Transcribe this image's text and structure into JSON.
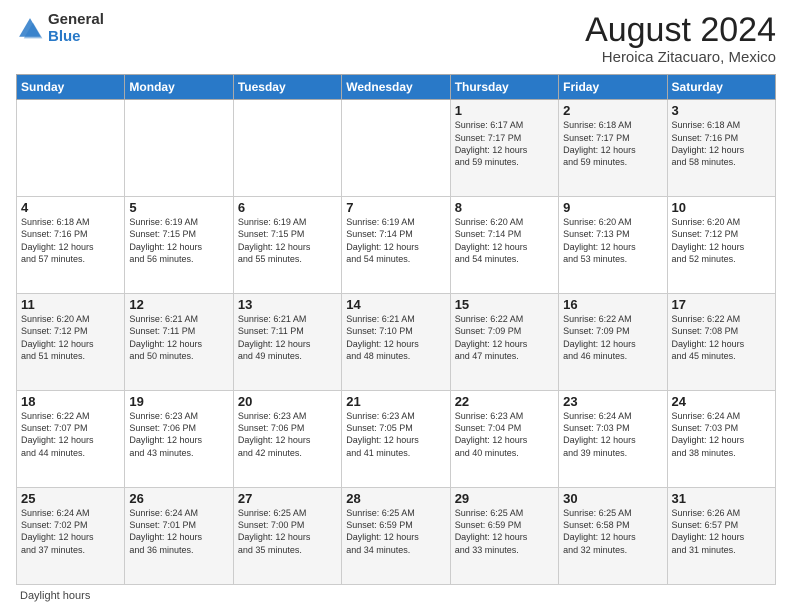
{
  "logo": {
    "general": "General",
    "blue": "Blue"
  },
  "title": "August 2024",
  "subtitle": "Heroica Zitacuaro, Mexico",
  "weekdays": [
    "Sunday",
    "Monday",
    "Tuesday",
    "Wednesday",
    "Thursday",
    "Friday",
    "Saturday"
  ],
  "footer_label": "Daylight hours",
  "weeks": [
    [
      {
        "day": "",
        "info": ""
      },
      {
        "day": "",
        "info": ""
      },
      {
        "day": "",
        "info": ""
      },
      {
        "day": "",
        "info": ""
      },
      {
        "day": "1",
        "info": "Sunrise: 6:17 AM\nSunset: 7:17 PM\nDaylight: 12 hours\nand 59 minutes."
      },
      {
        "day": "2",
        "info": "Sunrise: 6:18 AM\nSunset: 7:17 PM\nDaylight: 12 hours\nand 59 minutes."
      },
      {
        "day": "3",
        "info": "Sunrise: 6:18 AM\nSunset: 7:16 PM\nDaylight: 12 hours\nand 58 minutes."
      }
    ],
    [
      {
        "day": "4",
        "info": "Sunrise: 6:18 AM\nSunset: 7:16 PM\nDaylight: 12 hours\nand 57 minutes."
      },
      {
        "day": "5",
        "info": "Sunrise: 6:19 AM\nSunset: 7:15 PM\nDaylight: 12 hours\nand 56 minutes."
      },
      {
        "day": "6",
        "info": "Sunrise: 6:19 AM\nSunset: 7:15 PM\nDaylight: 12 hours\nand 55 minutes."
      },
      {
        "day": "7",
        "info": "Sunrise: 6:19 AM\nSunset: 7:14 PM\nDaylight: 12 hours\nand 54 minutes."
      },
      {
        "day": "8",
        "info": "Sunrise: 6:20 AM\nSunset: 7:14 PM\nDaylight: 12 hours\nand 54 minutes."
      },
      {
        "day": "9",
        "info": "Sunrise: 6:20 AM\nSunset: 7:13 PM\nDaylight: 12 hours\nand 53 minutes."
      },
      {
        "day": "10",
        "info": "Sunrise: 6:20 AM\nSunset: 7:12 PM\nDaylight: 12 hours\nand 52 minutes."
      }
    ],
    [
      {
        "day": "11",
        "info": "Sunrise: 6:20 AM\nSunset: 7:12 PM\nDaylight: 12 hours\nand 51 minutes."
      },
      {
        "day": "12",
        "info": "Sunrise: 6:21 AM\nSunset: 7:11 PM\nDaylight: 12 hours\nand 50 minutes."
      },
      {
        "day": "13",
        "info": "Sunrise: 6:21 AM\nSunset: 7:11 PM\nDaylight: 12 hours\nand 49 minutes."
      },
      {
        "day": "14",
        "info": "Sunrise: 6:21 AM\nSunset: 7:10 PM\nDaylight: 12 hours\nand 48 minutes."
      },
      {
        "day": "15",
        "info": "Sunrise: 6:22 AM\nSunset: 7:09 PM\nDaylight: 12 hours\nand 47 minutes."
      },
      {
        "day": "16",
        "info": "Sunrise: 6:22 AM\nSunset: 7:09 PM\nDaylight: 12 hours\nand 46 minutes."
      },
      {
        "day": "17",
        "info": "Sunrise: 6:22 AM\nSunset: 7:08 PM\nDaylight: 12 hours\nand 45 minutes."
      }
    ],
    [
      {
        "day": "18",
        "info": "Sunrise: 6:22 AM\nSunset: 7:07 PM\nDaylight: 12 hours\nand 44 minutes."
      },
      {
        "day": "19",
        "info": "Sunrise: 6:23 AM\nSunset: 7:06 PM\nDaylight: 12 hours\nand 43 minutes."
      },
      {
        "day": "20",
        "info": "Sunrise: 6:23 AM\nSunset: 7:06 PM\nDaylight: 12 hours\nand 42 minutes."
      },
      {
        "day": "21",
        "info": "Sunrise: 6:23 AM\nSunset: 7:05 PM\nDaylight: 12 hours\nand 41 minutes."
      },
      {
        "day": "22",
        "info": "Sunrise: 6:23 AM\nSunset: 7:04 PM\nDaylight: 12 hours\nand 40 minutes."
      },
      {
        "day": "23",
        "info": "Sunrise: 6:24 AM\nSunset: 7:03 PM\nDaylight: 12 hours\nand 39 minutes."
      },
      {
        "day": "24",
        "info": "Sunrise: 6:24 AM\nSunset: 7:03 PM\nDaylight: 12 hours\nand 38 minutes."
      }
    ],
    [
      {
        "day": "25",
        "info": "Sunrise: 6:24 AM\nSunset: 7:02 PM\nDaylight: 12 hours\nand 37 minutes."
      },
      {
        "day": "26",
        "info": "Sunrise: 6:24 AM\nSunset: 7:01 PM\nDaylight: 12 hours\nand 36 minutes."
      },
      {
        "day": "27",
        "info": "Sunrise: 6:25 AM\nSunset: 7:00 PM\nDaylight: 12 hours\nand 35 minutes."
      },
      {
        "day": "28",
        "info": "Sunrise: 6:25 AM\nSunset: 6:59 PM\nDaylight: 12 hours\nand 34 minutes."
      },
      {
        "day": "29",
        "info": "Sunrise: 6:25 AM\nSunset: 6:59 PM\nDaylight: 12 hours\nand 33 minutes."
      },
      {
        "day": "30",
        "info": "Sunrise: 6:25 AM\nSunset: 6:58 PM\nDaylight: 12 hours\nand 32 minutes."
      },
      {
        "day": "31",
        "info": "Sunrise: 6:26 AM\nSunset: 6:57 PM\nDaylight: 12 hours\nand 31 minutes."
      }
    ]
  ]
}
